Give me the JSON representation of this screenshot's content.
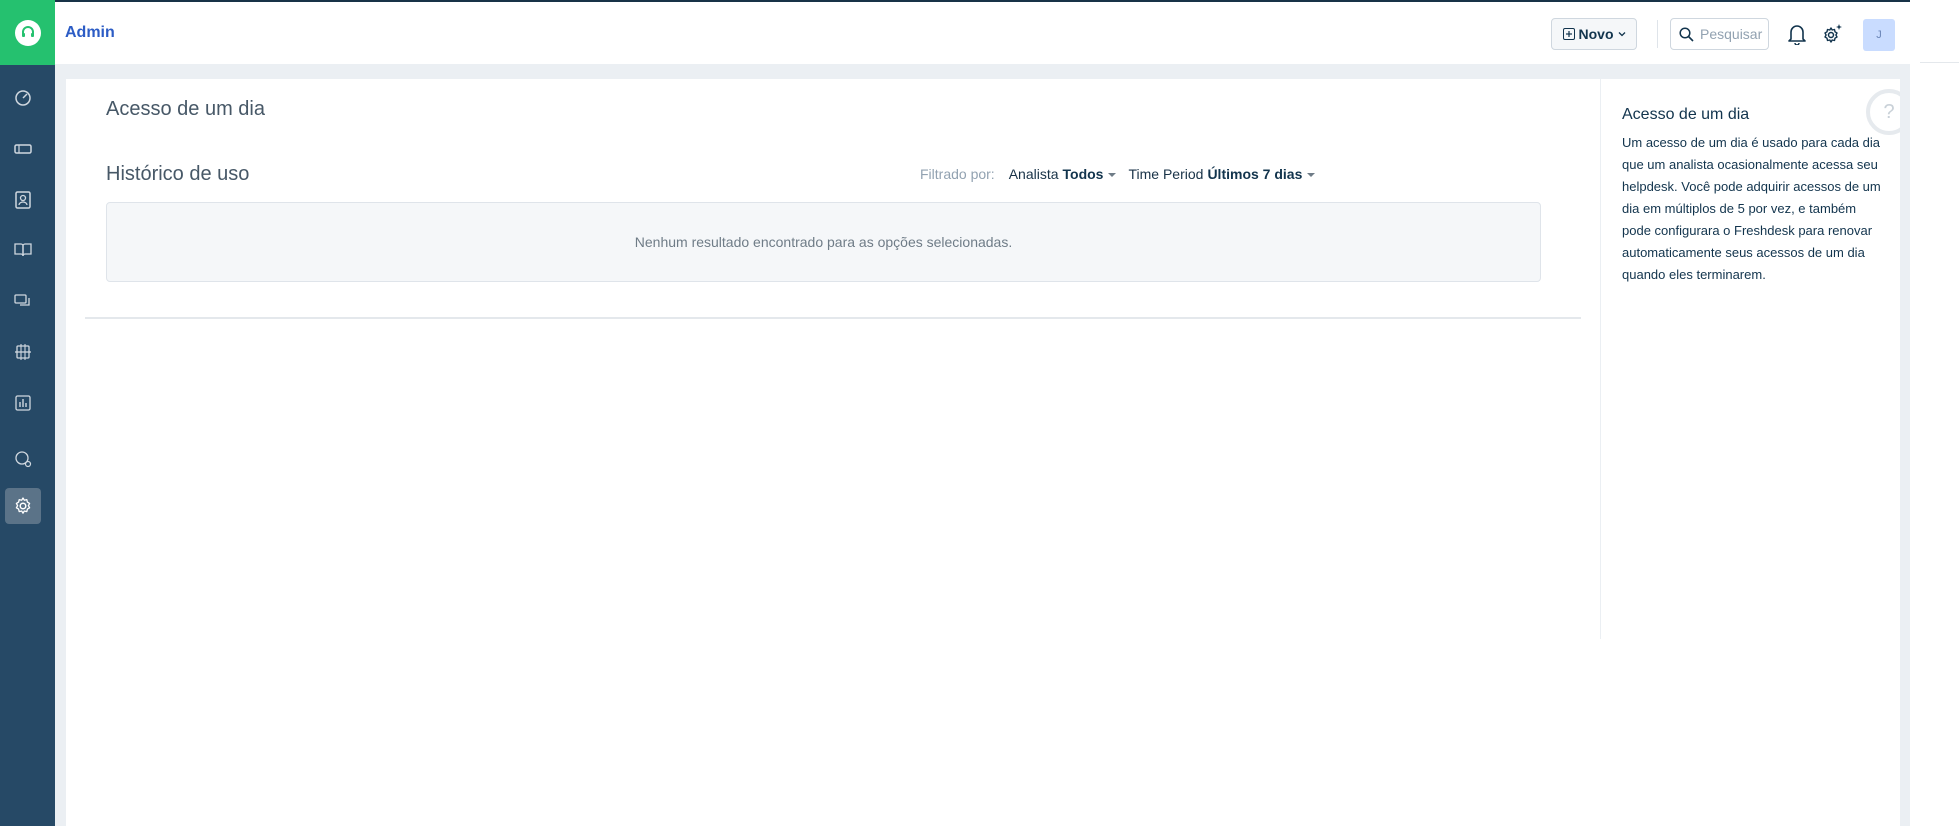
{
  "header": {
    "title": "Admin",
    "new_button_label": "Novo",
    "search_placeholder": "Pesquisar",
    "avatar_initial": "J"
  },
  "sidebar": {
    "items": [
      {
        "icon": "dashboard-icon"
      },
      {
        "icon": "tickets-icon"
      },
      {
        "icon": "contacts-icon"
      },
      {
        "icon": "solutions-book-icon"
      },
      {
        "icon": "forums-icon"
      },
      {
        "icon": "freshconnect-icon"
      },
      {
        "icon": "reports-icon"
      },
      {
        "icon": "chat-icon"
      },
      {
        "icon": "admin-gear-icon",
        "active": true
      }
    ]
  },
  "main": {
    "heading": "Acesso de um dia",
    "usage_heading": "Histórico de uso",
    "filters": {
      "label": "Filtrado por:",
      "agent_label": "Analista",
      "agent_value": "Todos",
      "period_label": "Time Period",
      "period_value": "Últimos 7 dias"
    },
    "empty_message": "Nenhum resultado encontrado para as opções selecionadas."
  },
  "help": {
    "title": "Acesso de um dia",
    "text": "Um acesso de um dia é usado para cada dia que um analista ocasionalmente acessa seu helpdesk. Você pode adquirir acessos de um dia em múltiplos de 5 por vez, e também pode configurara o Freshdesk para renovar automaticamente seus acessos de um dia quando eles terminarem.",
    "help_glyph": "?"
  },
  "colors": {
    "sidebar_bg": "#264966",
    "logo_bg": "#25c16f",
    "title_blue": "#2c5cc5",
    "content_bg": "#ebeff3"
  }
}
